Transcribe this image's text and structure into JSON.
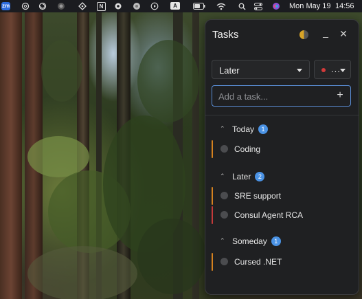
{
  "menubar": {
    "app_icons": [
      "zoom-icon",
      "openai-icon",
      "settings-spiral-icon",
      "record-icon",
      "slack-icon",
      "notion-icon",
      "gear-icon",
      "chrome-icon",
      "play-icon",
      "font-icon",
      "battery-icon",
      "wifi-icon",
      "search-icon",
      "control-center-icon",
      "siri-icon"
    ],
    "zoom_label": "zm",
    "notion_label": "N",
    "font_label": "A",
    "date": "Mon May 19",
    "time": "14:56"
  },
  "panel": {
    "title": "Tasks",
    "list_select": {
      "value": "Later"
    },
    "color_select": {
      "value": "...",
      "dot_color": "#d23a3a"
    },
    "add_input": {
      "placeholder": "Add a task...",
      "value": ""
    },
    "add_button": "+",
    "minimize_label": "_",
    "close_label": "✕",
    "groups": [
      {
        "name": "Today",
        "count": "1",
        "tasks": [
          {
            "label": "Coding",
            "color": "#d4811f"
          }
        ]
      },
      {
        "name": "Later",
        "count": "2",
        "tasks": [
          {
            "label": "SRE support",
            "color": "#d4811f"
          },
          {
            "label": "Consul Agent RCA",
            "color": "#c43a3a"
          }
        ]
      },
      {
        "name": "Someday",
        "count": "1",
        "tasks": [
          {
            "label": "Cursed .NET",
            "color": "#d4811f"
          }
        ]
      }
    ]
  },
  "colors": {
    "accent": "#4a92e4",
    "panel_bg": "#1f2022",
    "input_border": "#5b8fd8"
  }
}
